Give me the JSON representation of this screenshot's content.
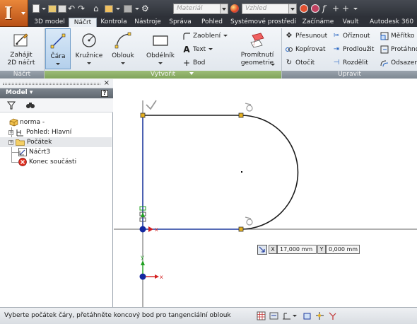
{
  "quick_access": {
    "material_placeholder": "Materiál",
    "appearance_placeholder": "Vzhled"
  },
  "tabs": [
    "3D model",
    "Náčrt",
    "Kontrola",
    "Nástroje",
    "Správa",
    "Pohled",
    "Systémové prostředí",
    "Začínáme",
    "Vault",
    "Autodesk 360"
  ],
  "active_tab": "Náčrt",
  "ribbon": {
    "groups": {
      "sketch": "Náčrt",
      "create": "Vytvořit",
      "modify": "Upravit"
    },
    "start_sketch": "Zahájit\n2D náčrt",
    "line": "Čára",
    "circle": "Kružnice",
    "arc": "Oblouk",
    "rectangle": "Obdélník",
    "fillet": "Zaoblení",
    "text": "Text",
    "point": "Bod",
    "project": "Promítnutí\ngeometrie",
    "move": "Přesunout",
    "copy": "Kopírovat",
    "rotate": "Otočit",
    "trim": "Oříznout",
    "extend": "Prodloužit",
    "split": "Rozdělit",
    "scale": "Měřítko",
    "stretch": "Protáhnou",
    "offset": "Odsazen"
  },
  "browser": {
    "title": "Model",
    "help": "?",
    "tree": [
      {
        "label": "norma -",
        "icon": "part-icon"
      },
      {
        "label": "Pohled: Hlavní",
        "icon": "view-icon"
      },
      {
        "label": "Počátek",
        "icon": "folder-icon"
      },
      {
        "label": "Náčrt3",
        "icon": "sketch-icon"
      },
      {
        "label": "Konec součásti",
        "icon": "end-of-part-icon"
      }
    ]
  },
  "canvas": {
    "x_label": "X",
    "x_value": "17,000 mm",
    "y_label": "Y",
    "y_value": "0,000 mm",
    "axis_x": "x",
    "axis_y": "y"
  },
  "status": {
    "message": "Vyberte počátek čáry, přetáhněte koncový bod pro tangenciální oblouk"
  },
  "colors": {
    "title_bar": "#2e3138",
    "app_button": "#d4692a",
    "draw_group": "#8fb068",
    "sketch_line": "#1f3a9e",
    "constraint_point": "#e6b020",
    "origin": "#1428a0",
    "x_axis": "#d42020",
    "y_axis": "#20a020"
  }
}
